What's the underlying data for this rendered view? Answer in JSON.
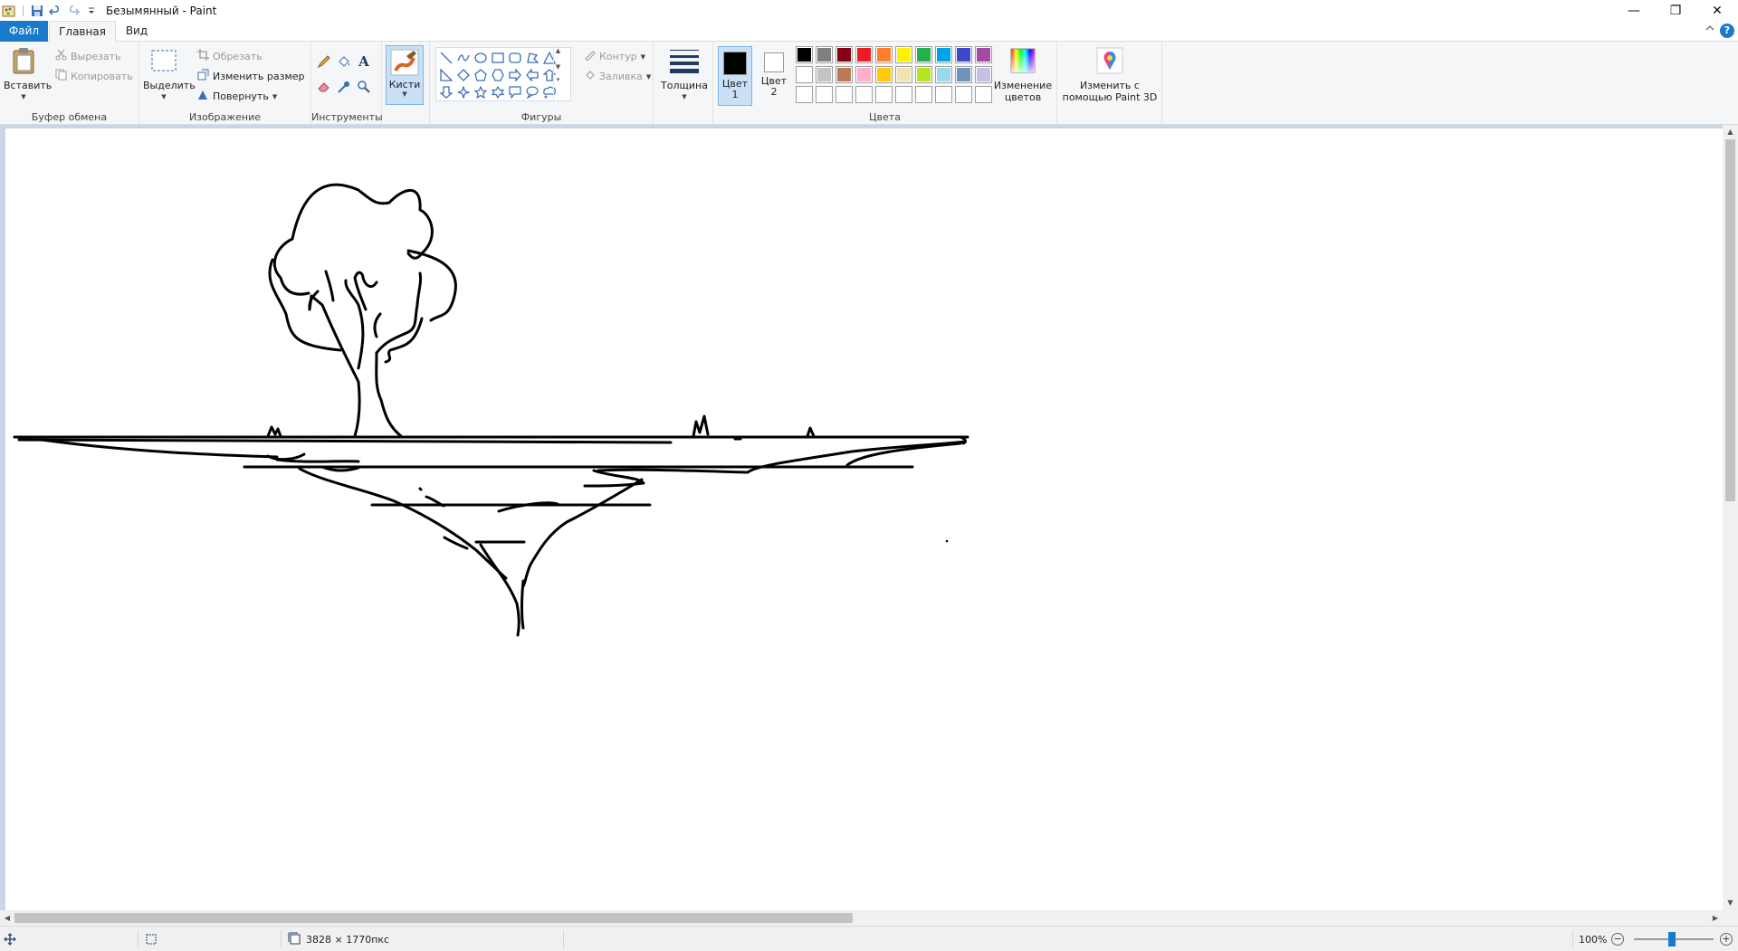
{
  "window": {
    "title": "Безымянный - Paint",
    "controls": {
      "minimize": "—",
      "restore": "❐",
      "close": "✕"
    }
  },
  "tabs": {
    "file": "Файл",
    "home": "Главная",
    "view": "Вид"
  },
  "help": "?",
  "ribbon": {
    "clipboard": {
      "paste": "Вставить",
      "cut": "Вырезать",
      "copy": "Копировать",
      "group_label": "Буфер обмена"
    },
    "image": {
      "select": "Выделить",
      "crop": "Обрезать",
      "resize": "Изменить размер",
      "rotate": "Повернуть",
      "group_label": "Изображение"
    },
    "tools": {
      "group_label": "Инструменты",
      "text_tool_glyph": "A"
    },
    "brushes": {
      "label": "Кисти"
    },
    "shapes": {
      "outline": "Контур",
      "fill": "Заливка",
      "group_label": "Фигуры"
    },
    "size": {
      "label": "Толщина"
    },
    "colors": {
      "color1_line1": "Цвет",
      "color1_line2": "1",
      "color2_line1": "Цвет",
      "color2_line2": "2",
      "edit_line1": "Изменение",
      "edit_line2": "цветов",
      "group_label": "Цвета",
      "color1_value": "#000000",
      "color2_value": "#ffffff",
      "palette": [
        "#000000",
        "#7f7f7f",
        "#880015",
        "#ed1c24",
        "#ff7f27",
        "#fff200",
        "#22b14c",
        "#00a2e8",
        "#3f48cc",
        "#a349a4",
        "#ffffff",
        "#c3c3c3",
        "#b97a57",
        "#ffaec9",
        "#ffc90e",
        "#efe4b0",
        "#b5e61d",
        "#99d9ea",
        "#7092be",
        "#c8bfe7",
        "#ffffff",
        "#ffffff",
        "#ffffff",
        "#ffffff",
        "#ffffff",
        "#ffffff",
        "#ffffff",
        "#ffffff",
        "#ffffff",
        "#ffffff"
      ]
    },
    "paint3d": {
      "line1": "Изменить с",
      "line2": "помощью Paint 3D"
    }
  },
  "status": {
    "image_size": "3828 × 1770пкс",
    "zoom": "100%",
    "zoom_out": "−",
    "zoom_in": "+"
  }
}
